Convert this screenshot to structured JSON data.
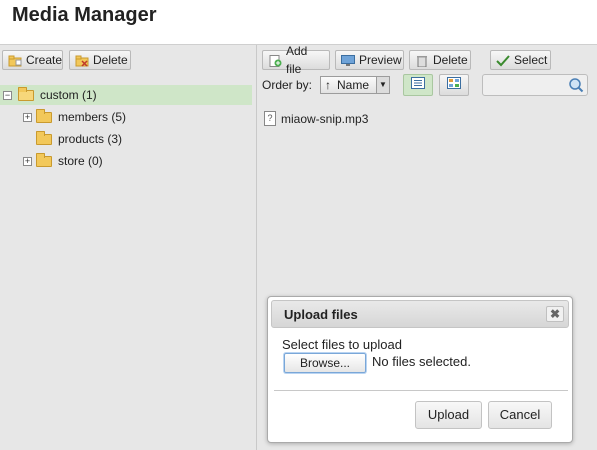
{
  "app": {
    "title": "Media Manager"
  },
  "left_toolbar": {
    "create_label": "Create",
    "delete_label": "Delete"
  },
  "tree": {
    "root": {
      "label": "custom (1)",
      "expanded": true
    },
    "children": [
      {
        "label": "members (5)",
        "expandable": true
      },
      {
        "label": "products (3)",
        "expandable": false
      },
      {
        "label": "store (0)",
        "expandable": true
      }
    ]
  },
  "right_toolbar": {
    "add_file_label": "Add file",
    "preview_label": "Preview",
    "delete_label": "Delete",
    "select_label": "Select"
  },
  "order": {
    "label": "Order by:",
    "value": "Name",
    "direction_symbol": "↑"
  },
  "search": {
    "placeholder": ""
  },
  "files": [
    {
      "name": "miaow-snip.mp3"
    }
  ],
  "dialog": {
    "title": "Upload files",
    "close_symbol": "✖",
    "prompt": "Select files to upload",
    "browse_label": "Browse...",
    "status": "No files selected.",
    "upload_label": "Upload",
    "cancel_label": "Cancel"
  },
  "colors": {
    "selected_row": "#cfe6c8",
    "pane_bg": "#e7e7e7"
  }
}
